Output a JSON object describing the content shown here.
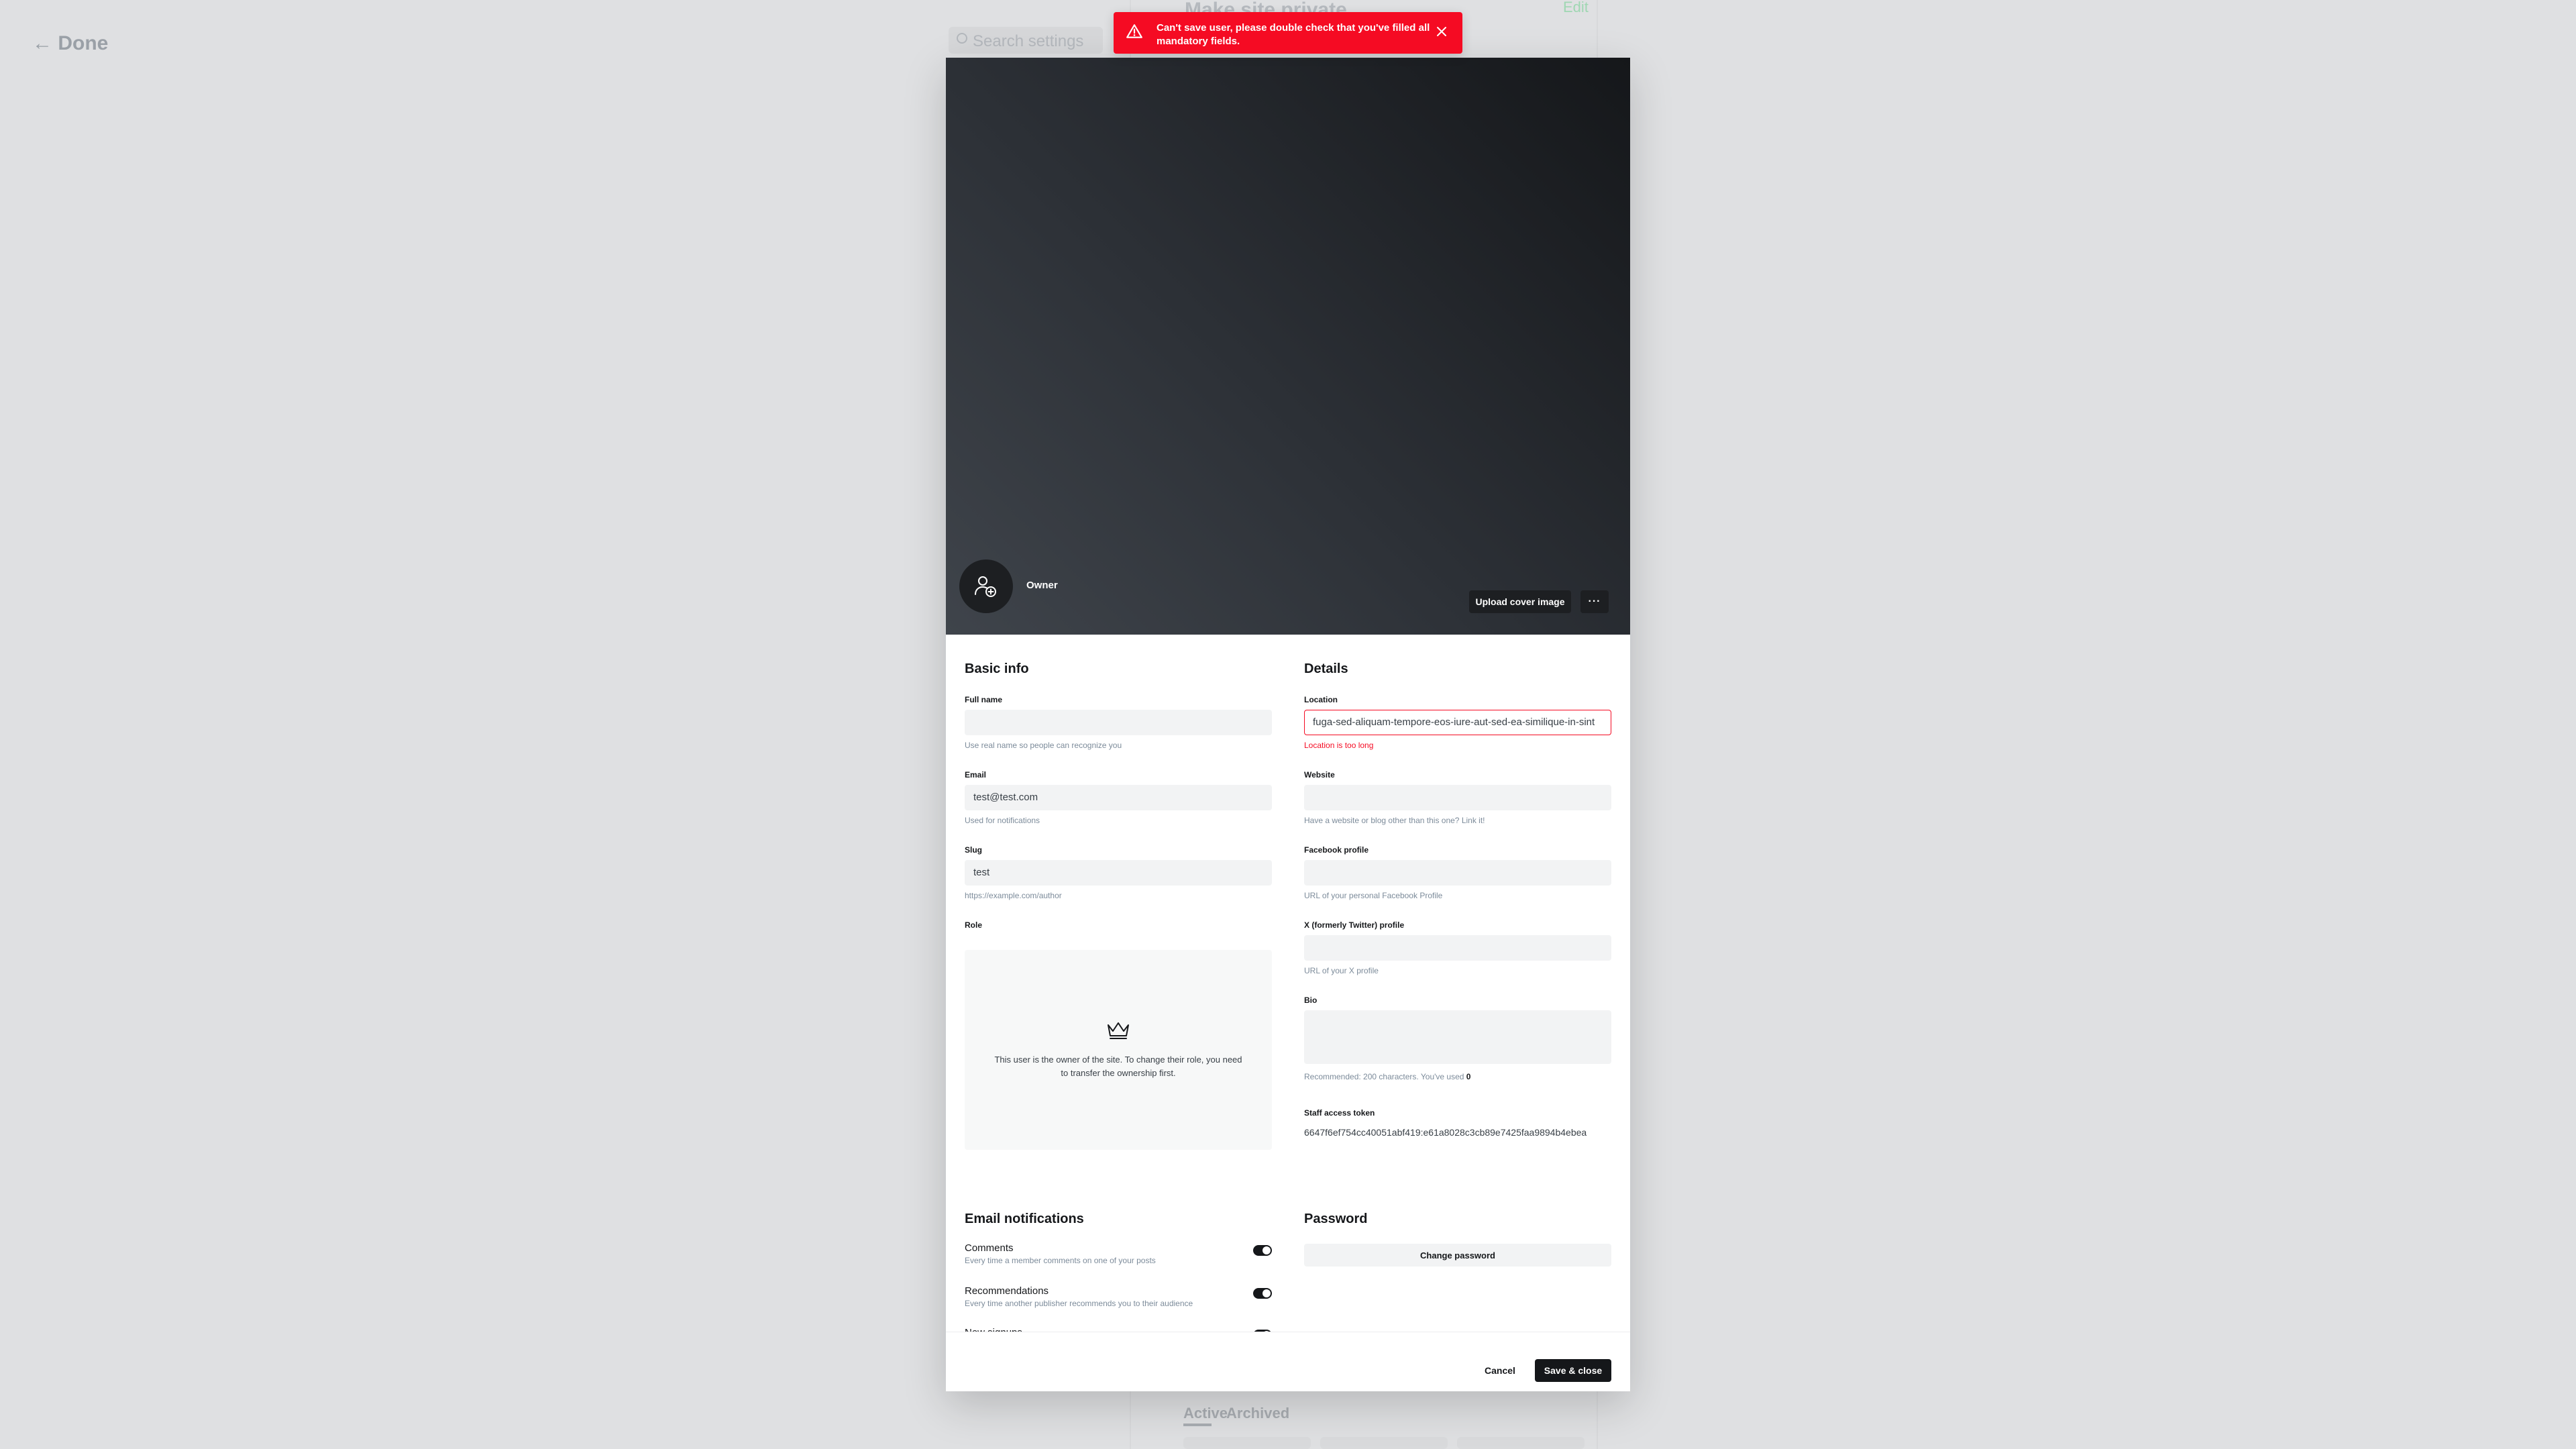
{
  "background": {
    "done_label": "← Done",
    "search_placeholder": "Search settings",
    "section_title": "Make site private",
    "edit_label": "Edit",
    "tab_active": "Active",
    "tab_archived": "Archived"
  },
  "toast": {
    "message": "Can't save user, please double check that you've filled all mandatory fields.",
    "color": "#f50b23"
  },
  "cover": {
    "role_label": "Owner",
    "upload_label": "Upload cover image",
    "more_label": "···"
  },
  "basic_info": {
    "title": "Basic info",
    "full_name": {
      "label": "Full name",
      "value": "",
      "hint": "Use real name so people can recognize you"
    },
    "email": {
      "label": "Email",
      "value": "test@test.com",
      "hint": "Used for notifications"
    },
    "slug": {
      "label": "Slug",
      "value": "test",
      "hint": "https://example.com/author"
    },
    "role": {
      "label": "Role",
      "message": "This user is the owner of the site. To change their role, you need to transfer the ownership first."
    }
  },
  "details": {
    "title": "Details",
    "location": {
      "label": "Location",
      "value": "fuga-sed-aliquam-tempore-eos-iure-aut-sed-ea-similique-in-sint",
      "error": "Location is too long"
    },
    "website": {
      "label": "Website",
      "value": "",
      "hint": "Have a website or blog other than this one? Link it!"
    },
    "facebook": {
      "label": "Facebook profile",
      "value": "",
      "hint": "URL of your personal Facebook Profile"
    },
    "twitter": {
      "label": "X (formerly Twitter) profile",
      "value": "",
      "hint": "URL of your X profile"
    },
    "bio": {
      "label": "Bio",
      "hint_prefix": "Recommended: 200 characters. You've used",
      "count": "0"
    },
    "token": {
      "label": "Staff access token",
      "value": "6647f6ef754cc40051abf419:e61a8028c3cb89e7425faa9894b4ebea"
    }
  },
  "email_notifications": {
    "title": "Email notifications",
    "items": [
      {
        "title": "Comments",
        "description": "Every time a member comments on one of your posts",
        "enabled": true
      },
      {
        "title": "Recommendations",
        "description": "Every time another publisher recommends you to their audience",
        "enabled": true
      },
      {
        "title": "New signups",
        "description": "",
        "enabled": true
      }
    ]
  },
  "password": {
    "title": "Password",
    "change_label": "Change password"
  },
  "footer": {
    "cancel_label": "Cancel",
    "save_label": "Save & close"
  }
}
